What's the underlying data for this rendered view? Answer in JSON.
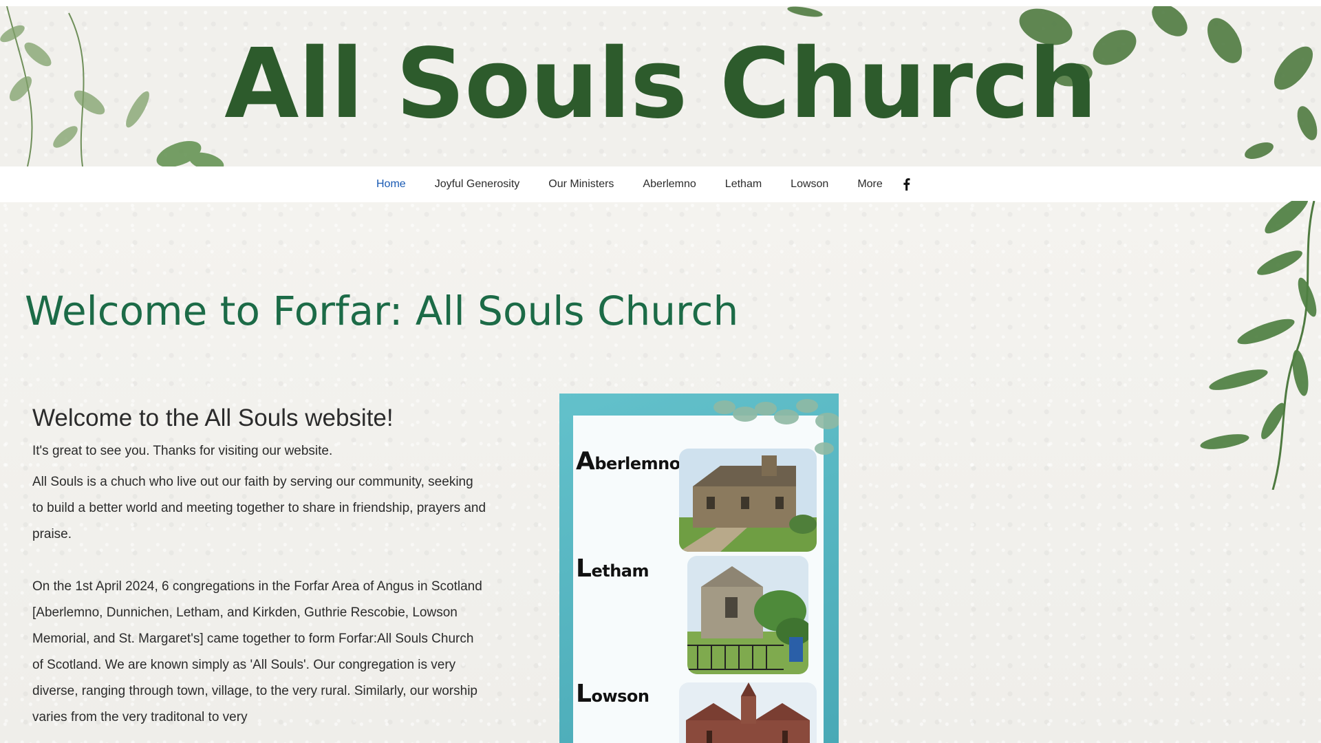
{
  "site": {
    "title": "All Souls Church"
  },
  "nav": {
    "items": [
      {
        "label": "Home",
        "active": true
      },
      {
        "label": "Joyful Generosity",
        "active": false
      },
      {
        "label": "Our Ministers",
        "active": false
      },
      {
        "label": "Aberlemno",
        "active": false
      },
      {
        "label": "Letham",
        "active": false
      },
      {
        "label": "Lowson",
        "active": false
      },
      {
        "label": "More",
        "active": false
      }
    ],
    "social_icon": "facebook-icon"
  },
  "main": {
    "heading": "Welcome to Forfar: All Souls Church",
    "welcome_title": "Welcome to the All Souls website!",
    "paragraphs": [
      "It's great to see you.  Thanks for visiting our website.",
      "All Souls is a chuch who live out our faith by serving our community, seeking to build a better world and meeting together to share in friendship, prayers and praise.",
      "On the 1st April 2024, 6 congregations in the Forfar Area of Angus in Scotland [Aberlemno, Dunnichen, Letham, and Kirkden, Guthrie Rescobie, Lowson Memorial, and St. Margaret's] came together to form Forfar:All Souls Church of Scotland.  We are known simply as 'All Souls'. Our congregation is very diverse, ranging through town, village, to the very rural. Similarly, our worship varies from the very traditonal to very"
    ]
  },
  "poster": {
    "entries": [
      {
        "initial": "A",
        "rest": "berlemno"
      },
      {
        "initial": "L",
        "rest": "etham"
      },
      {
        "initial": "L",
        "rest": "owson"
      }
    ]
  },
  "colors": {
    "title_green": "#2d5b2c",
    "heading_green": "#1c6b47",
    "nav_active": "#1859b3",
    "poster_teal": "#5bb8c3"
  }
}
